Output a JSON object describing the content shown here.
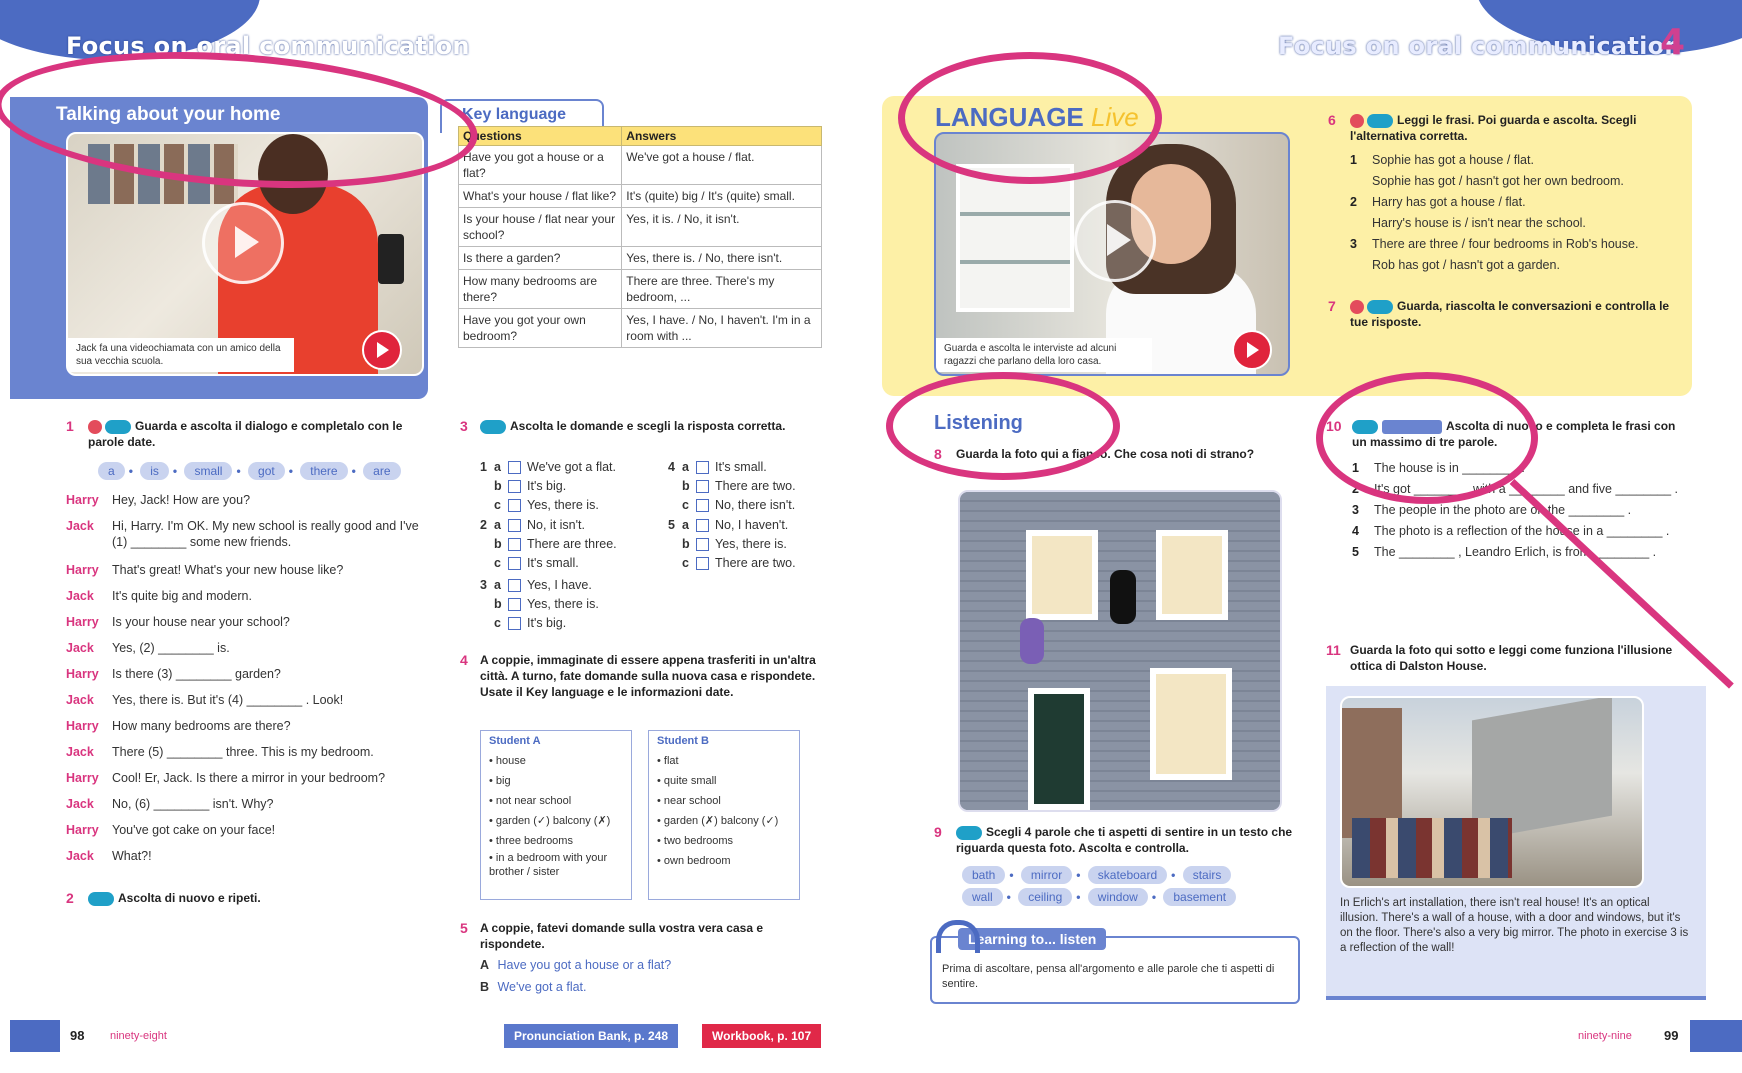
{
  "header": {
    "left": "Focus on oral communication",
    "right": "Focus on oral communication",
    "chapter": "4"
  },
  "left_page": {
    "panel_title": "Talking about your home",
    "video_caption": "Jack fa una videochiamata con un amico della sua vecchia scuola.",
    "key_language": {
      "tab": "Key language",
      "headers": [
        "Questions",
        "Answers"
      ],
      "rows": [
        [
          "Have you got a house or a flat?",
          "We've got a house / flat."
        ],
        [
          "What's your house / flat like?",
          "It's (quite) big / It's (quite) small."
        ],
        [
          "Is your house / flat near your school?",
          "Yes, it is. / No, it isn't."
        ],
        [
          "Is there a garden?",
          "Yes, there is. / No, there isn't."
        ],
        [
          "How many bedrooms are there?",
          "There are three. There's my bedroom, ..."
        ],
        [
          "Have you got your own bedroom?",
          "Yes, I have. / No, I haven't. I'm in a room with ..."
        ]
      ]
    },
    "ex1": {
      "num": "1",
      "text": "Guarda e ascolta il dialogo e completalo con le parole date.",
      "words": [
        "a",
        "is",
        "small",
        "got",
        "there",
        "are"
      ]
    },
    "dialogue": [
      {
        "sp": "Harry",
        "t": "Hey, Jack! How are you?"
      },
      {
        "sp": "Jack",
        "t": "Hi, Harry. I'm OK. My new school is really good and I've (1) ________ some new friends."
      },
      {
        "sp": "Harry",
        "t": "That's great! What's your new house like?"
      },
      {
        "sp": "Jack",
        "t": "It's quite big and modern."
      },
      {
        "sp": "Harry",
        "t": "Is your house near your school?"
      },
      {
        "sp": "Jack",
        "t": "Yes, (2) ________ is."
      },
      {
        "sp": "Harry",
        "t": "Is there (3) ________ garden?"
      },
      {
        "sp": "Jack",
        "t": "Yes, there is. But it's (4) ________ . Look!"
      },
      {
        "sp": "Harry",
        "t": "How many bedrooms are there?"
      },
      {
        "sp": "Jack",
        "t": "There (5) ________ three. This is my bedroom."
      },
      {
        "sp": "Harry",
        "t": "Cool! Er, Jack. Is there a mirror in your bedroom?"
      },
      {
        "sp": "Jack",
        "t": "No, (6) ________ isn't. Why?"
      },
      {
        "sp": "Harry",
        "t": "You've got cake on your face!"
      },
      {
        "sp": "Jack",
        "t": "What?!"
      }
    ],
    "ex2": {
      "num": "2",
      "text": "Ascolta di nuovo e ripeti."
    },
    "ex3": {
      "num": "3",
      "text": "Ascolta le domande e scegli la risposta corretta.",
      "groups": [
        {
          "n": "1",
          "opts": [
            "We've got a flat.",
            "It's big.",
            "Yes, there is."
          ]
        },
        {
          "n": "2",
          "opts": [
            "No, it isn't.",
            "There are three.",
            "It's small."
          ]
        },
        {
          "n": "3",
          "opts": [
            "Yes, I have.",
            "Yes, there is.",
            "It's big."
          ]
        },
        {
          "n": "4",
          "opts": [
            "It's small.",
            "There are two.",
            "No, there isn't."
          ]
        },
        {
          "n": "5",
          "opts": [
            "No, I haven't.",
            "Yes, there is.",
            "There are two."
          ]
        }
      ]
    },
    "ex4": {
      "num": "4",
      "text": "A coppie, immaginate di essere appena trasferiti in un'altra città. A turno, fate domande sulla nuova casa e rispondete. Usate il Key language e le informazioni date.",
      "studentA": {
        "title": "Student A",
        "items": [
          "house",
          "big",
          "not near school",
          "garden (✓) balcony (✗)",
          "three bedrooms",
          "in a bedroom with your brother / sister"
        ]
      },
      "studentB": {
        "title": "Student B",
        "items": [
          "flat",
          "quite small",
          "near school",
          "garden (✗) balcony (✓)",
          "two bedrooms",
          "own bedroom"
        ]
      }
    },
    "ex5": {
      "num": "5",
      "text": "A coppie, fatevi domande sulla vostra vera casa e rispondete.",
      "a": "Have you got a house or a flat?",
      "b": "We've got a flat."
    },
    "page_num": "98",
    "page_word": "ninety-eight",
    "pron_btn": "Pronunciation Bank, p. 248",
    "work_btn": "Workbook, p. 107"
  },
  "right_page": {
    "lang_title": "LANGUAGE",
    "lang_live": "Live",
    "video_caption": "Guarda e ascolta le interviste ad alcuni ragazzi che parlano della loro casa.",
    "ex6": {
      "num": "6",
      "text": "Leggi le frasi. Poi guarda e ascolta. Scegli l'alternativa corretta.",
      "items": [
        {
          "n": "1",
          "t": "Sophie has got a house / flat."
        },
        {
          "n": "",
          "t": "Sophie has got / hasn't got her own bedroom."
        },
        {
          "n": "2",
          "t": "Harry has got a house / flat."
        },
        {
          "n": "",
          "t": "Harry's house is / isn't near the school."
        },
        {
          "n": "3",
          "t": "There are three / four bedrooms in Rob's house."
        },
        {
          "n": "",
          "t": "Rob has got / hasn't got a garden."
        }
      ]
    },
    "ex7": {
      "num": "7",
      "text": "Guarda, riascolta le conversazioni e controlla le tue risposte."
    },
    "listening_title": "Listening",
    "ex8": {
      "num": "8",
      "text": "Guarda la foto qui a fianco. Che cosa noti di strano?"
    },
    "ex9": {
      "num": "9",
      "text": "Scegli 4 parole che ti aspetti di sentire in un testo che riguarda questa foto. Ascolta e controlla.",
      "words_row1": [
        "bath",
        "mirror",
        "skateboard",
        "stairs"
      ],
      "words_row2": [
        "wall",
        "ceiling",
        "window",
        "basement"
      ]
    },
    "learning": {
      "tab": "Learning to... listen",
      "text": "Prima di ascoltare, pensa all'argomento e alle parole che ti aspetti di sentire."
    },
    "ex10": {
      "num": "10",
      "text": "Ascolta di nuovo e completa le frasi con un massimo di tre parole.",
      "items": [
        {
          "n": "1",
          "t": "The house is in ________ ."
        },
        {
          "n": "2",
          "t": "It's got ________ with a ________ and five ________ ."
        },
        {
          "n": "3",
          "t": "The people in the photo are on the ________ ."
        },
        {
          "n": "4",
          "t": "The photo is a reflection of the house in a ________ ."
        },
        {
          "n": "5",
          "t": "The ________ , Leandro Erlich, is from ________ ."
        }
      ]
    },
    "ex11": {
      "num": "11",
      "text": "Guarda la foto qui sotto e leggi come funziona l'illusione ottica di Dalston House."
    },
    "blue_text": "In Erlich's art installation, there isn't real house! It's an optical illusion. There's a wall of a house, with a door and windows, but it's on the floor. There's also a very big mirror. The photo in exercise 3 is a reflection of the wall!",
    "page_word": "ninety-nine",
    "page_num": "99"
  }
}
